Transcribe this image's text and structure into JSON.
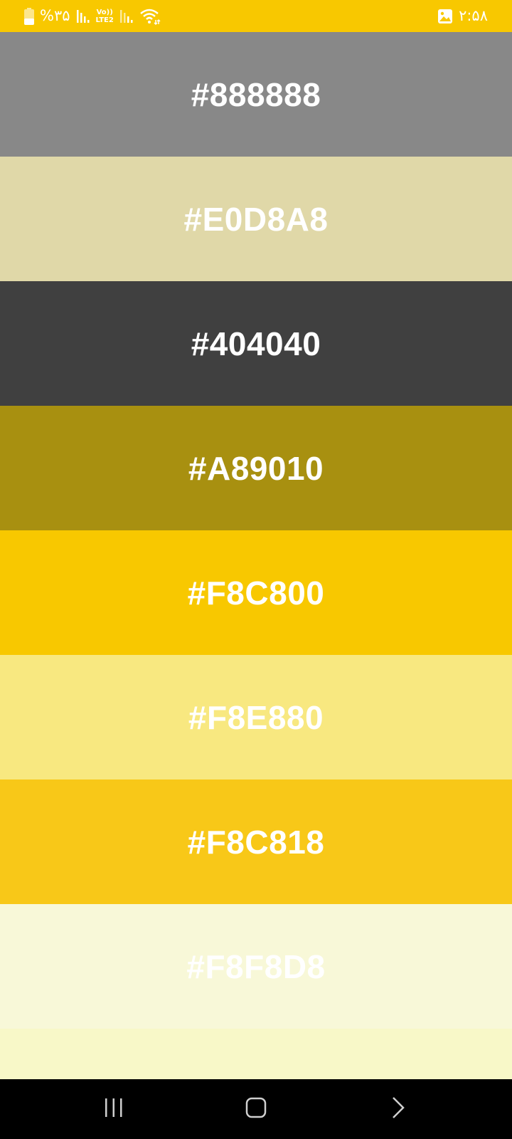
{
  "status_bar": {
    "battery_percent": "%۳۵",
    "network_label_top": "Vo))",
    "network_label_bottom": "LTE2",
    "time": "۲:۵۸",
    "background": "#F8C800",
    "icons": [
      "battery-icon",
      "signal-icon",
      "signal-icon-2",
      "wifi-icon",
      "gallery-notification-icon"
    ]
  },
  "swatches": [
    {
      "label": "#888888",
      "color": "#888888"
    },
    {
      "label": "#E0D8A8",
      "color": "#E0D8A8"
    },
    {
      "label": "#404040",
      "color": "#404040"
    },
    {
      "label": "#A89010",
      "color": "#A89010"
    },
    {
      "label": "#F8C800",
      "color": "#F8C800"
    },
    {
      "label": "#F8E880",
      "color": "#F8E880"
    },
    {
      "label": "#F8C818",
      "color": "#F8C818"
    },
    {
      "label": "#F8F8D8",
      "color": "#F8F8D8"
    },
    {
      "label": "",
      "color": "#F8F8C8"
    }
  ],
  "nav_bar": {
    "buttons": [
      "recent-apps-icon",
      "home-icon",
      "back-icon"
    ]
  }
}
